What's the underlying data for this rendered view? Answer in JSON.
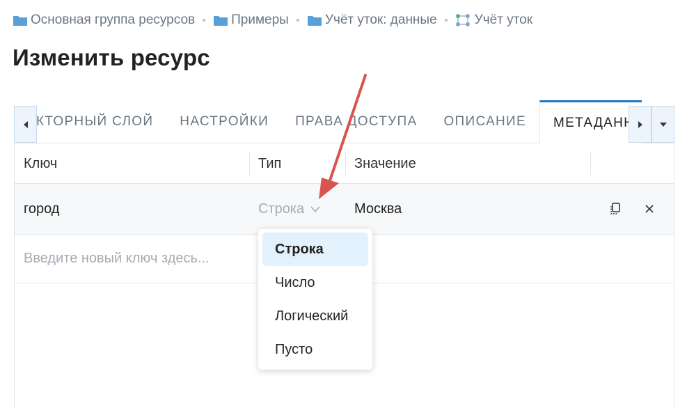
{
  "breadcrumb": {
    "items": [
      {
        "label": "Основная группа ресурсов",
        "icon": "folder-icon"
      },
      {
        "label": "Примеры",
        "icon": "folder-icon"
      },
      {
        "label": "Учёт уток: данные",
        "icon": "folder-icon"
      },
      {
        "label": "Учёт уток",
        "icon": "vector-layer-icon"
      }
    ]
  },
  "page_title": "Изменить ресурс",
  "tabs": {
    "items": [
      {
        "label": "ВЕКТОРНЫЙ СЛОЙ"
      },
      {
        "label": "НАСТРОЙКИ"
      },
      {
        "label": "ПРАВА ДОСТУПА"
      },
      {
        "label": "ОПИСАНИЕ"
      },
      {
        "label": "МЕТАДАННЫЕ"
      }
    ],
    "active_index": 4
  },
  "table": {
    "headers": {
      "key": "Ключ",
      "type": "Тип",
      "value": "Значение"
    },
    "rows": [
      {
        "key": "город",
        "type": "Строка",
        "value": "Москва"
      }
    ],
    "new_key_placeholder": "Введите новый ключ здесь..."
  },
  "type_dropdown": {
    "options": [
      "Строка",
      "Число",
      "Логический",
      "Пусто"
    ],
    "selected": "Строка"
  },
  "colors": {
    "accent": "#1e78c8",
    "folder": "#5aa0d8",
    "selected_option_bg": "#e3f1fc",
    "annotation_arrow": "#d9534f"
  }
}
